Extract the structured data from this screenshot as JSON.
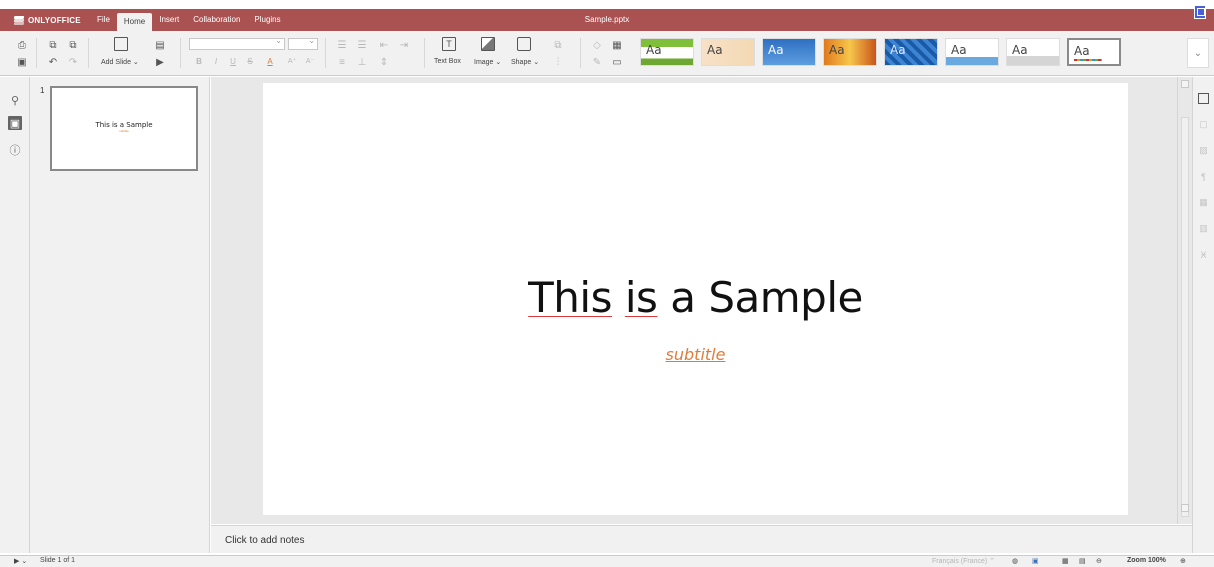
{
  "titlebar": {
    "logo": "ONLYOFFICE",
    "tabs": [
      "File",
      "Home",
      "Insert",
      "Collaboration",
      "Plugins"
    ],
    "active_tab": "Home",
    "document_title": "Sample.pptx"
  },
  "toolbar": {
    "add_slide": "Add Slide",
    "text_box": "Text Box",
    "image": "Image",
    "shape": "Shape",
    "bold": "B",
    "italic": "I",
    "underline": "U",
    "strike": "S",
    "font_color": "A",
    "themes": [
      "Aa",
      "Aa",
      "Aa",
      "Aa",
      "Aa",
      "Aa",
      "Aa",
      "Aa"
    ]
  },
  "thumbnails": {
    "slide_number": "1",
    "title": "This is a Sample",
    "subtitle": "subtitle"
  },
  "slide": {
    "title_word1": "This",
    "title_word2": "is",
    "title_rest": "a Sample",
    "subtitle": "subtitle"
  },
  "notes": {
    "placeholder": "Click to add notes"
  },
  "statusbar": {
    "slide_info": "Slide 1 of 1",
    "language": "Français (France)",
    "zoom": "Zoom 100%"
  },
  "colors": {
    "titlebar": "#aa5252",
    "subtitle": "#e07b39",
    "spellcheck_underline": "#d63b3b"
  }
}
